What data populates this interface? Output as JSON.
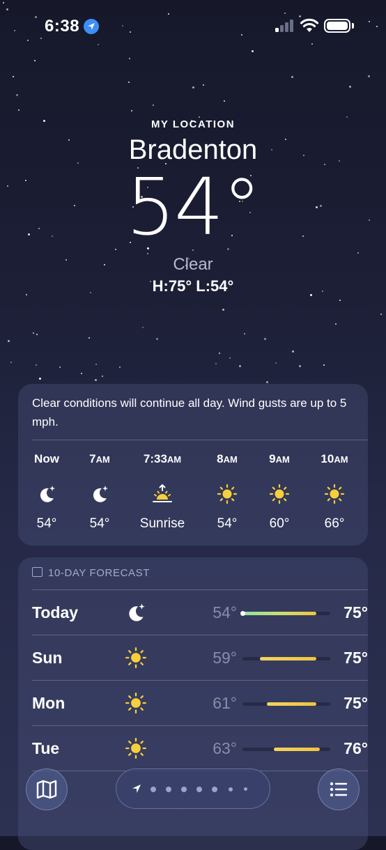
{
  "status_bar": {
    "time": "6:38"
  },
  "header": {
    "my_location": "MY LOCATION",
    "city": "Bradenton",
    "temperature": "54°",
    "condition": "Clear",
    "high_low": "H:75°  L:54°"
  },
  "hourly": {
    "summary": "Clear conditions will continue all day. Wind gusts are up to 5 mph.",
    "items": [
      {
        "label": "Now",
        "suffix": "",
        "icon": "moon-stars-icon",
        "value": "54°"
      },
      {
        "label": "7",
        "suffix": "AM",
        "icon": "moon-stars-icon",
        "value": "54°"
      },
      {
        "label": "7:33",
        "suffix": "AM",
        "icon": "sunrise-icon",
        "value": "Sunrise"
      },
      {
        "label": "8",
        "suffix": "AM",
        "icon": "sun-icon",
        "value": "54°"
      },
      {
        "label": "9",
        "suffix": "AM",
        "icon": "sun-icon",
        "value": "60°"
      },
      {
        "label": "10",
        "suffix": "AM",
        "icon": "sun-icon",
        "value": "66°"
      }
    ]
  },
  "forecast": {
    "title": "10-DAY FORECAST",
    "range_min": 54,
    "range_max": 79,
    "days": [
      {
        "day": "Today",
        "icon": "moon-stars-icon",
        "low": "54°",
        "high": "75°",
        "low_val": 54,
        "high_val": 75,
        "current": 54
      },
      {
        "day": "Sun",
        "icon": "sun-icon",
        "low": "59°",
        "high": "75°",
        "low_val": 59,
        "high_val": 75
      },
      {
        "day": "Mon",
        "icon": "sun-icon",
        "low": "61°",
        "high": "75°",
        "low_val": 61,
        "high_val": 75
      },
      {
        "day": "Tue",
        "icon": "sun-icon",
        "low": "63°",
        "high": "76°",
        "low_val": 63,
        "high_val": 76
      }
    ]
  },
  "toolbar": {
    "map_icon": "map-icon",
    "list_icon": "list-icon",
    "location_icon": "location-arrow-icon",
    "page_count": 7
  },
  "colors": {
    "sun": "#f6cf3b",
    "accent": "#3d8ef7"
  }
}
